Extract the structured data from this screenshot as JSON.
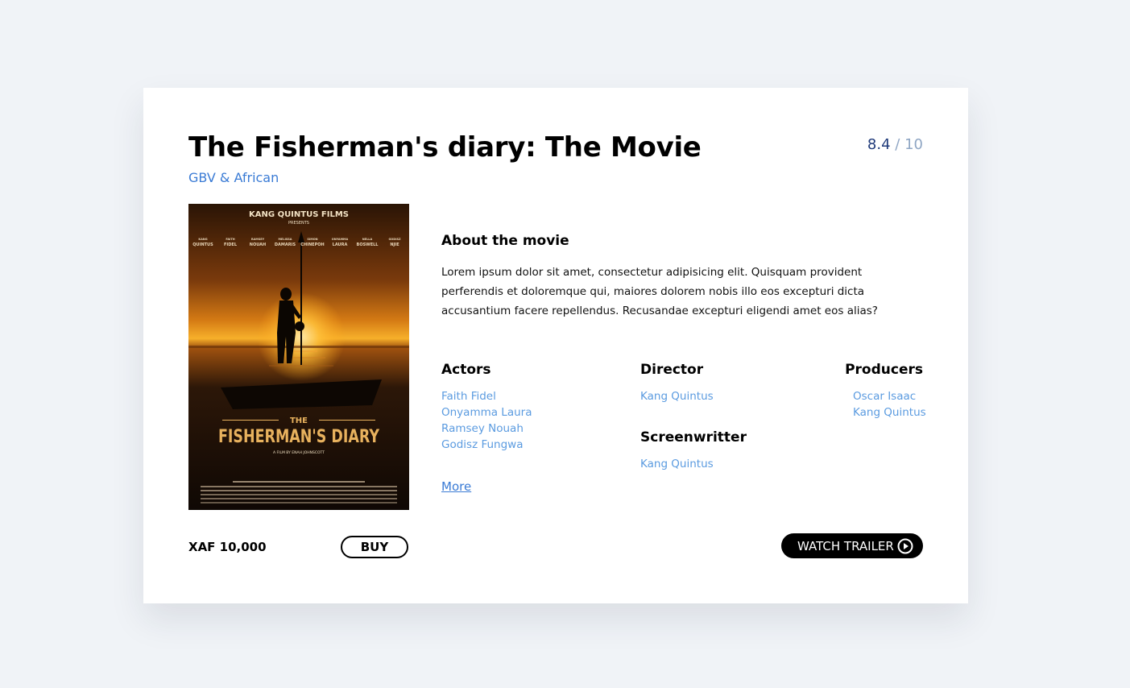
{
  "movie": {
    "title": "The Fisherman's diary: The Movie",
    "genre": "GBV & African",
    "rating": {
      "score": "8.4",
      "separator": "/",
      "max": "10"
    }
  },
  "poster": {
    "studio": "KANG QUINTUS FILMS",
    "presents": "PRESENTS",
    "cast_line": [
      "KANG QUINTUS",
      "FAITH FIDEL",
      "RAMSEY NOUAH",
      "MELISSA DAMARIS",
      "SIMON CHINEPOH",
      "ONYAMMA LAURA",
      "NELLA BOSWELL",
      "GODISZ NJIE"
    ],
    "title_small": "THE",
    "title_big": "FISHERMAN'S DIARY",
    "tagline": "A FILM BY ENAH JOHNSCOTT",
    "colors": {
      "sky_top": "#3b1e08",
      "sun": "#f5a31a",
      "sea": "#1e1107",
      "title_gold": "#e0b25a"
    }
  },
  "about": {
    "heading": "About the movie",
    "text": "Lorem ipsum dolor sit amet, consectetur adipisicing elit. Quisquam provident perferendis et doloremque qui, maiores dolorem nobis illo eos excepturi dicta accusantium facere repellendus. Recusandae excepturi eligendi amet eos alias?"
  },
  "credits": {
    "actors": {
      "heading": "Actors",
      "names": [
        "Faith Fidel",
        "Onyamma Laura",
        "Ramsey Nouah",
        "Godisz Fungwa"
      ]
    },
    "director": {
      "heading": "Director",
      "names": [
        "Kang Quintus"
      ]
    },
    "screenwriter": {
      "heading": "Screenwritter",
      "names": [
        "Kang Quintus"
      ]
    },
    "producers": {
      "heading": "Producers",
      "names": [
        "Oscar Isaac",
        "Kang Quintus"
      ]
    },
    "more_label": "More"
  },
  "purchase": {
    "price": "XAF 10,000",
    "buy_label": "BUY",
    "trailer_label": "WATCH TRAILER"
  },
  "icons": {
    "trailer": "play-circle-icon"
  }
}
